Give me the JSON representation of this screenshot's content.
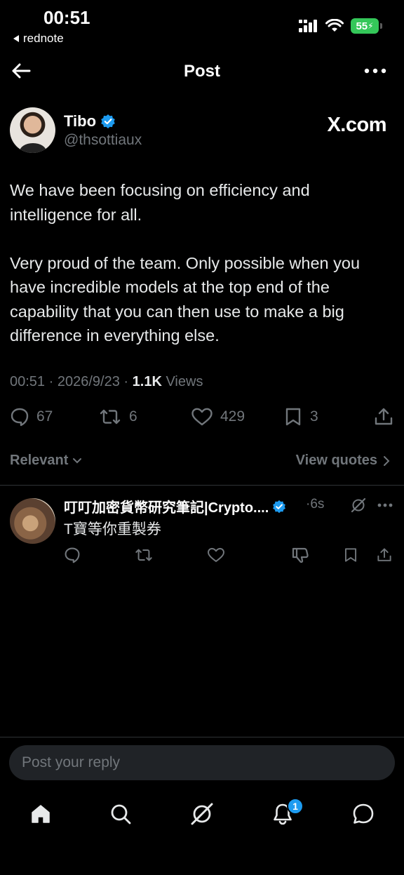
{
  "status": {
    "time": "00:51",
    "back_app": "rednote",
    "battery": "55"
  },
  "nav": {
    "title": "Post"
  },
  "post": {
    "author_name": "Tibo",
    "handle": "@thsottiaux",
    "source": "X.com",
    "body": "We have been focusing on efficiency and intelligence for all.\n\nVery proud of the team. Only possible when you have incredible models at the top end of the capability that you can then use to make a big difference in everything else.",
    "time": "00:51",
    "sep1": "·",
    "date": "2026/9/23",
    "sep2": "·",
    "views_count": "1.1K",
    "views_label": "Views",
    "replies": "67",
    "reposts": "6",
    "likes": "429",
    "bookmarks": "3"
  },
  "sort": {
    "relevant": "Relevant",
    "view_quotes": "View quotes"
  },
  "reply": {
    "author_name": "叮叮加密貨幣研究筆記|Crypto....",
    "time": "·6s",
    "text": "T寶等你重製券"
  },
  "composer": {
    "placeholder": "Post your reply"
  },
  "notifications_badge": "1",
  "colors": {
    "accent": "#1d9bf0",
    "background": "#000000",
    "muted": "#71767b",
    "battery": "#34c759"
  }
}
